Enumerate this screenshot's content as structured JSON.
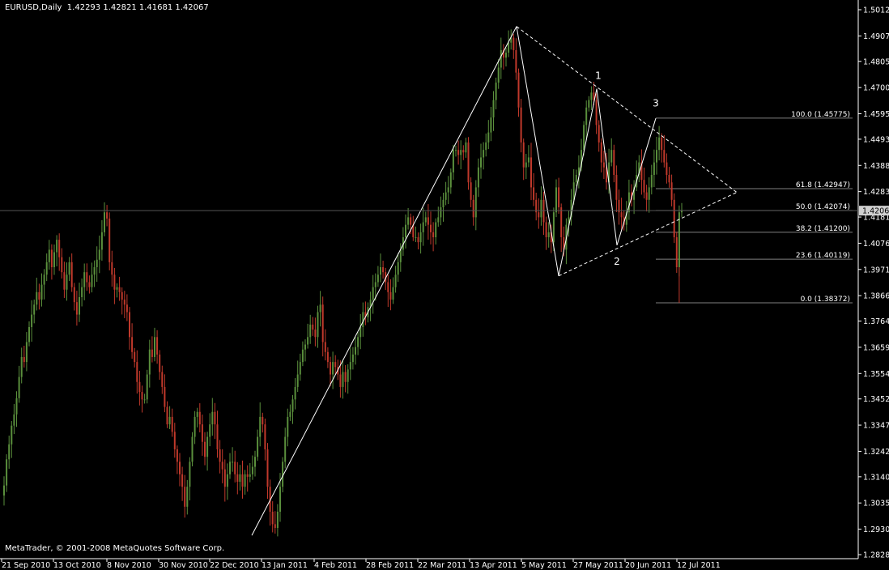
{
  "header": {
    "symbol": "EURUSD,Daily",
    "ohlc": "1.42293 1.42821 1.41681 1.42067"
  },
  "footer": {
    "copyright": "MetaTrader, © 2001-2008 MetaQuotes Software Corp."
  },
  "colors": {
    "background": "#000000",
    "axis": "#ffffff",
    "bull": "#5a8f3c",
    "bear": "#c0392b",
    "trendline": "#ffffff",
    "fib": "#808080",
    "price_tag_bg": "#d0d0d0"
  },
  "chart_data": {
    "type": "candlestick",
    "symbol": "EURUSD",
    "timeframe": "Daily",
    "current_price": "1.42067",
    "y_ticks": [
      "1.50120",
      "1.49070",
      "1.48050",
      "1.47000",
      "1.45950",
      "1.44930",
      "1.43880",
      "1.42830",
      "1.41810",
      "1.40760",
      "1.39710",
      "1.38660",
      "1.37640",
      "1.36590",
      "1.35540",
      "1.34520",
      "1.33470",
      "1.32420",
      "1.31400",
      "1.30350",
      "1.29300",
      "1.28280"
    ],
    "ylim": [
      1.2828,
      1.5012
    ],
    "x_ticks": [
      "21 Sep 2010",
      "13 Oct 2010",
      "8 Nov 2010",
      "30 Nov 2010",
      "22 Dec 2010",
      "13 Jan 2011",
      "4 Feb 2011",
      "28 Feb 2011",
      "22 Mar 2011",
      "13 Apr 2011",
      "5 May 2011",
      "27 May 2011",
      "20 Jun 2011",
      "12 Jul 2011"
    ],
    "closes": [
      1.3105,
      1.321,
      1.327,
      1.3345,
      1.339,
      1.3455,
      1.354,
      1.362,
      1.36,
      1.368,
      1.374,
      1.379,
      1.383,
      1.388,
      1.385,
      1.391,
      1.395,
      1.4,
      1.405,
      1.398,
      1.404,
      1.409,
      1.402,
      1.396,
      1.389,
      1.395,
      1.4,
      1.39,
      1.384,
      1.379,
      1.386,
      1.39,
      1.396,
      1.392,
      1.39,
      1.395,
      1.398,
      1.401,
      1.405,
      1.412,
      1.42,
      1.4175,
      1.4,
      1.395,
      1.389,
      1.39,
      1.388,
      1.385,
      1.383,
      1.38,
      1.37,
      1.364,
      1.36,
      1.352,
      1.348,
      1.345,
      1.345,
      1.355,
      1.365,
      1.362,
      1.37,
      1.363,
      1.356,
      1.35,
      1.342,
      1.335,
      1.338,
      1.332,
      1.325,
      1.32,
      1.315,
      1.31,
      1.302,
      1.31,
      1.32,
      1.33,
      1.338,
      1.34,
      1.335,
      1.328,
      1.322,
      1.33,
      1.335,
      1.34,
      1.335,
      1.325,
      1.32,
      1.317,
      1.31,
      1.315,
      1.32,
      1.32,
      1.315,
      1.312,
      1.315,
      1.31,
      1.315,
      1.314,
      1.315,
      1.318,
      1.322,
      1.33,
      1.338,
      1.335,
      1.325,
      1.31,
      1.3,
      1.295,
      1.2935,
      1.3,
      1.31,
      1.32,
      1.33,
      1.338,
      1.34,
      1.345,
      1.35,
      1.355,
      1.36,
      1.365,
      1.367,
      1.37,
      1.375,
      1.373,
      1.37,
      1.38,
      1.383,
      1.368,
      1.364,
      1.36,
      1.355,
      1.36,
      1.358,
      1.355,
      1.35,
      1.356,
      1.352,
      1.357,
      1.36,
      1.363,
      1.366,
      1.37,
      1.374,
      1.38,
      1.378,
      1.382,
      1.385,
      1.39,
      1.392,
      1.395,
      1.398,
      1.396,
      1.392,
      1.388,
      1.385,
      1.39,
      1.395,
      1.4,
      1.405,
      1.41,
      1.415,
      1.418,
      1.415,
      1.41,
      1.41,
      1.408,
      1.412,
      1.416,
      1.418,
      1.415,
      1.412,
      1.41,
      1.416,
      1.418,
      1.422,
      1.425,
      1.428,
      1.43,
      1.436,
      1.445,
      1.445,
      1.443,
      1.445,
      1.444,
      1.448,
      1.432,
      1.425,
      1.418,
      1.43,
      1.438,
      1.442,
      1.445,
      1.448,
      1.452,
      1.458,
      1.465,
      1.472,
      1.478,
      1.485,
      1.482,
      1.484,
      1.488,
      1.49,
      1.485,
      1.476,
      1.462,
      1.448,
      1.438,
      1.44,
      1.442,
      1.43,
      1.425,
      1.42,
      1.418,
      1.425,
      1.416,
      1.41,
      1.412,
      1.408,
      1.42,
      1.43,
      1.422,
      1.41,
      1.405,
      1.415,
      1.418,
      1.425,
      1.432,
      1.435,
      1.438,
      1.445,
      1.455,
      1.462,
      1.465,
      1.468,
      1.465,
      1.455,
      1.448,
      1.44,
      1.438,
      1.432,
      1.44,
      1.445,
      1.435,
      1.425,
      1.42,
      1.418,
      1.415,
      1.42,
      1.428,
      1.425,
      1.43,
      1.435,
      1.44,
      1.433,
      1.428,
      1.425,
      1.43,
      1.435,
      1.44,
      1.445,
      1.45,
      1.445,
      1.44,
      1.435,
      1.432,
      1.425,
      1.41,
      1.398,
      1.42,
      1.4207
    ],
    "fib_levels": [
      {
        "label": "100.0 (1.45775)",
        "value": 1.45775
      },
      {
        "label": "61.8 (1.42947)",
        "value": 1.42947
      },
      {
        "label": "50.0 (1.42074)",
        "value": 1.42074
      },
      {
        "label": "38.2 (1.41200)",
        "value": 1.412
      },
      {
        "label": "23.6 (1.40119)",
        "value": 1.40119
      },
      {
        "label": "0.0 (1.38372)",
        "value": 1.38372
      }
    ],
    "wave_labels": [
      "1",
      "2",
      "3"
    ]
  }
}
